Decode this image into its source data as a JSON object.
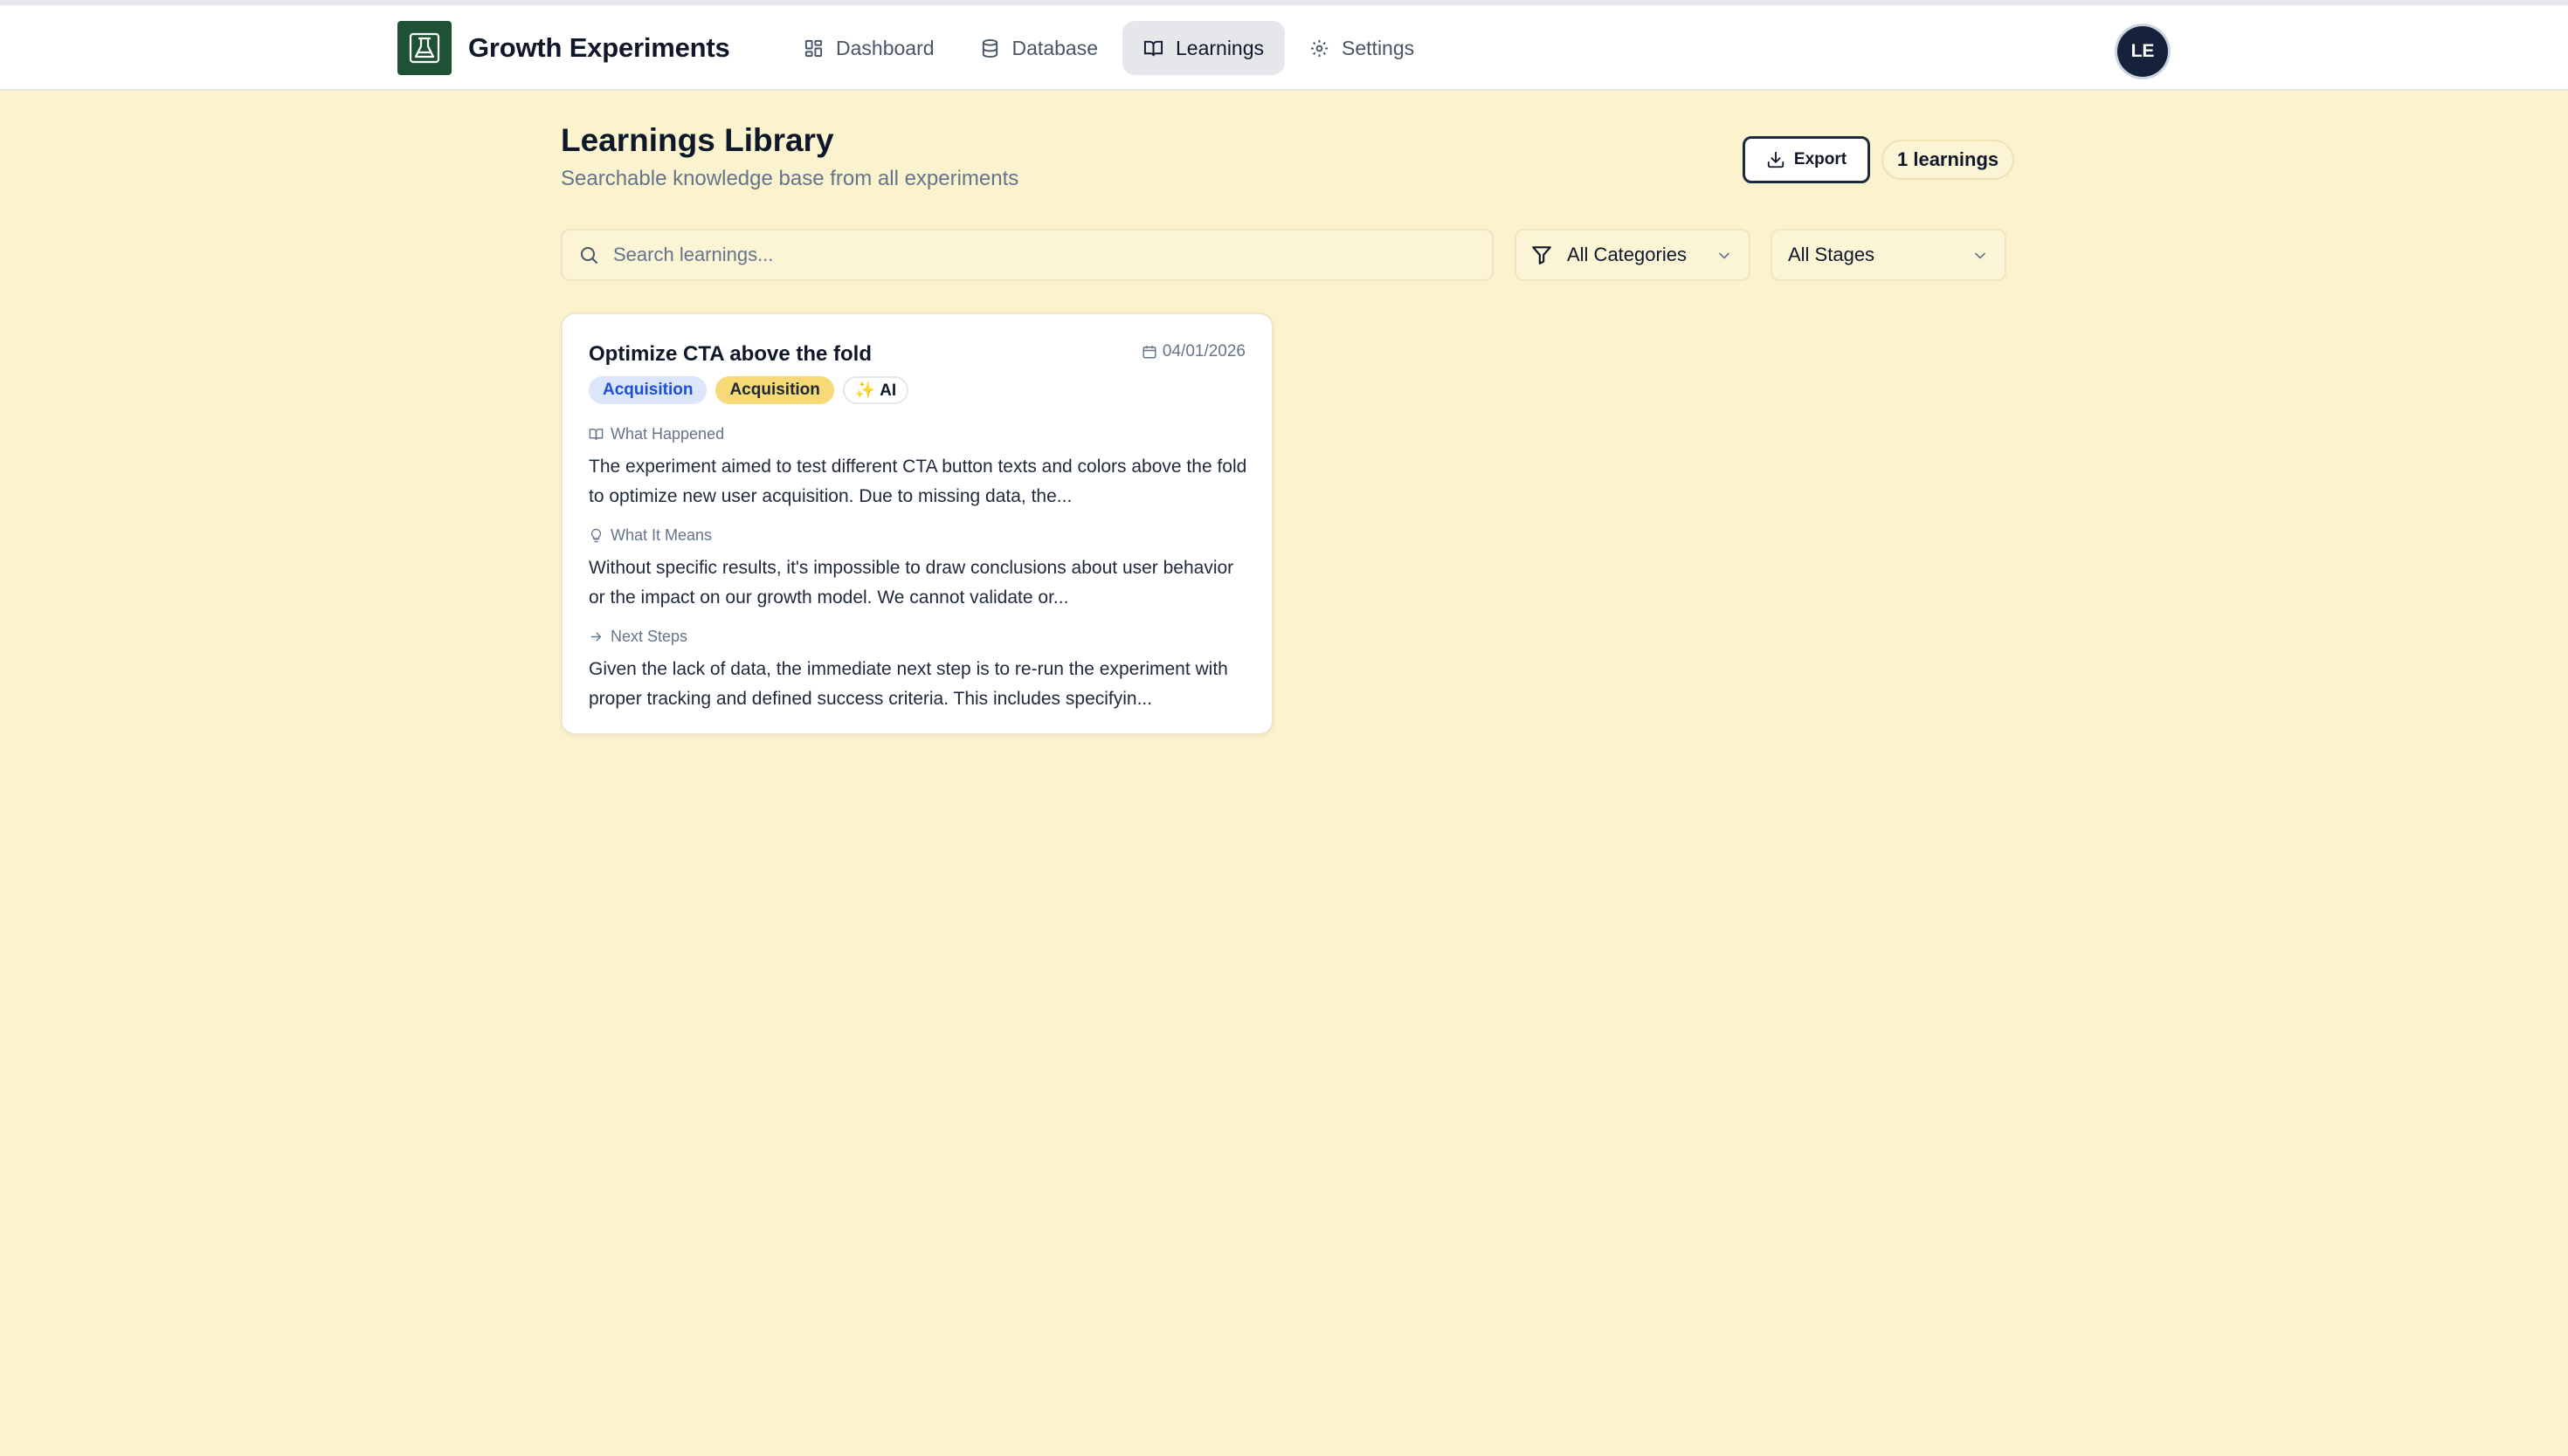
{
  "app": {
    "brand": "Growth Experiments",
    "logo_icon": "flask-icon",
    "nav": [
      {
        "label": "Dashboard",
        "icon": "dashboard-icon",
        "active": false
      },
      {
        "label": "Database",
        "icon": "database-icon",
        "active": false
      },
      {
        "label": "Learnings",
        "icon": "book-icon",
        "active": true
      },
      {
        "label": "Settings",
        "icon": "gear-icon",
        "active": false
      }
    ],
    "avatar": "LE"
  },
  "page": {
    "title": "Learnings Library",
    "subtitle": "Searchable knowledge base from all experiments",
    "export_label": "Export",
    "count_label": "1 learnings"
  },
  "filters": {
    "search_placeholder": "Search learnings...",
    "search_value": "",
    "category": "All Categories",
    "stage": "All Stages"
  },
  "learnings": [
    {
      "title": "Optimize CTA above the fold",
      "date": "04/01/2026",
      "tags": [
        "Acquisition",
        "Acquisition"
      ],
      "ai_badge": "✨ AI",
      "sections": [
        {
          "label": "What Happened",
          "icon": "book-icon",
          "text": "The experiment aimed to test different CTA button texts and colors above the fold to optimize new user acquisition. Due to missing data, the..."
        },
        {
          "label": "What It Means",
          "icon": "lightbulb-icon",
          "text": "Without specific results, it's impossible to draw conclusions about user behavior or the impact on our growth model. We cannot validate or..."
        },
        {
          "label": "Next Steps",
          "icon": "arrow-right-icon",
          "text": "Given the lack of data, the immediate next step is to re-run the experiment with proper tracking and defined success criteria. This includes specifyin..."
        }
      ]
    }
  ],
  "colors": {
    "background": "#faf3cd",
    "brand_green": "#1f5135",
    "avatar_bg": "#16213b",
    "tag_blue_bg": "#dbe6fb",
    "tag_yellow_bg": "#f7d977"
  }
}
